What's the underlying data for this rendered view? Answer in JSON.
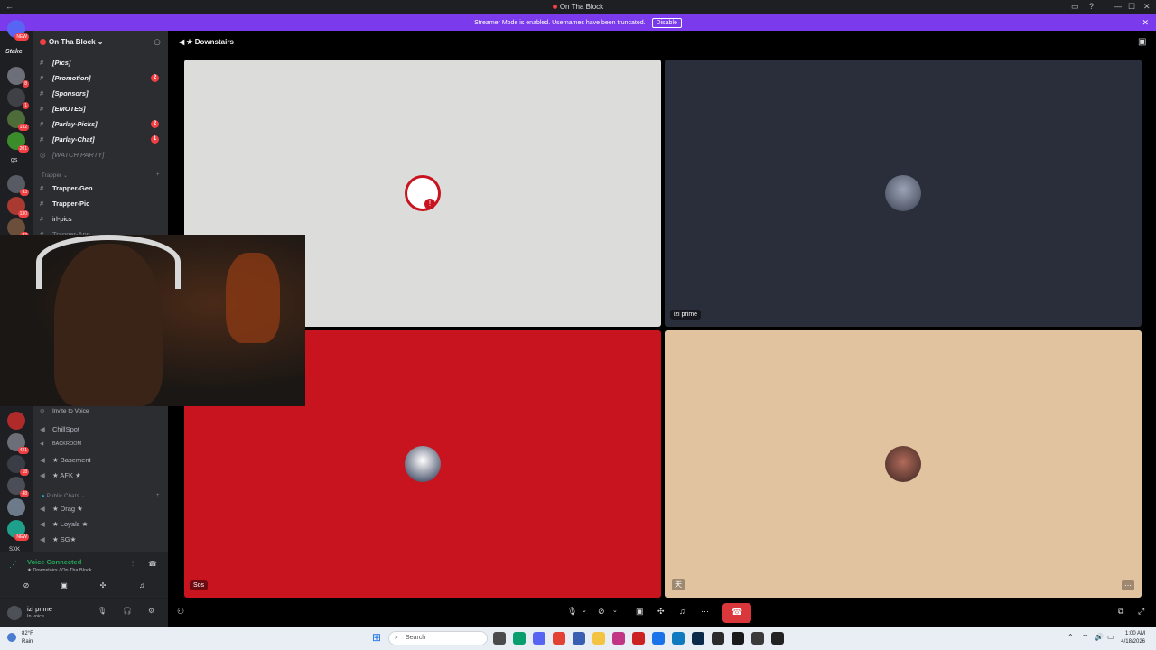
{
  "window": {
    "title": "On Tha Block"
  },
  "banner": {
    "message": "Streamer Mode is enabled. Usernames have been truncated.",
    "disable_label": "Disable"
  },
  "server": {
    "name": "On Tha Block",
    "top_channels": [
      {
        "label": "[Pics]",
        "badge": ""
      },
      {
        "label": "[Promotion]",
        "badge": "2"
      },
      {
        "label": "[Sponsors]",
        "badge": ""
      },
      {
        "label": "[EMOTES]",
        "badge": ""
      },
      {
        "label": "[Parlay-Picks]",
        "badge": "2"
      },
      {
        "label": "[Parlay-Chat]",
        "badge": "1"
      },
      {
        "label": "[WATCH PARTY]",
        "badge": ""
      }
    ],
    "category_trapper": "Trapper",
    "trapper_channels": [
      "Trapper-Gen",
      "Trapper-Pic",
      "irl-pics",
      "Trapper-App"
    ],
    "invite_label": "Invite to Voice",
    "voice_channels": [
      "ChillSpot",
      "BACKROOM",
      "★ Basement",
      "★ AFK ★"
    ],
    "category_public": "Public Chats",
    "public_channels": [
      "★ Drag ★",
      "★ Loyals ★",
      "★ SG★"
    ]
  },
  "rail": {
    "badges": [
      "NEW",
      "8",
      "1",
      "132",
      "201",
      "83",
      "130",
      "37",
      "421",
      "18",
      "48",
      "NEW"
    ],
    "labels": [
      "Stake",
      "gs",
      "SXK"
    ]
  },
  "voice": {
    "status": "Voice Connected",
    "location": "★ Downstairs / On Tha Block"
  },
  "user": {
    "name": "izi prime",
    "status": "In voice"
  },
  "call": {
    "channel_title": "★ Downstairs",
    "tiles": [
      {
        "label": ""
      },
      {
        "label": "izi prime"
      },
      {
        "label": "Sos"
      },
      {
        "label": ""
      }
    ],
    "tile_colors": [
      "#dcdcdb",
      "#2a2d3a",
      "#c8141f",
      "#e2c3a0"
    ]
  },
  "taskbar": {
    "weather_temp": "82°F",
    "weather_desc": "Rain",
    "search_placeholder": "Search",
    "time": "1:00 AM",
    "date": "4/18/2026"
  },
  "colors": {
    "accent": "#7c3aed",
    "danger": "#da373c",
    "connected": "#23a55a"
  },
  "icons": [
    "hash-icon",
    "speaker-icon",
    "mic-icon",
    "headphones-icon",
    "gear-icon",
    "phone-hangup-icon",
    "search-icon",
    "windows-icon"
  ]
}
